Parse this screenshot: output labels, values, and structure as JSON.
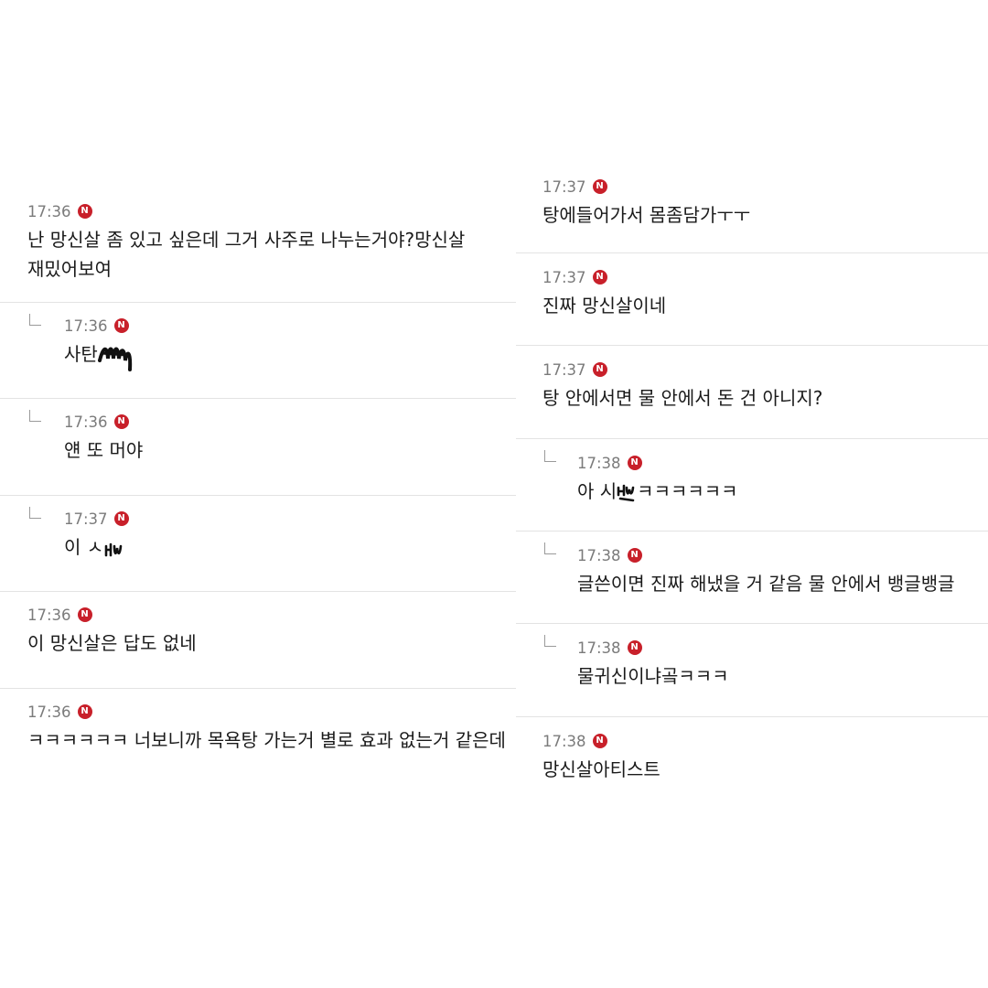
{
  "badge_letter": "N",
  "badge_color": "#c8202a",
  "left_comments": [
    {
      "time": "17:36",
      "reply": false,
      "text": "난 망신살 좀 있고 싶은데 그거 사주로 나누는거야?망신살 재밌어보여"
    },
    {
      "time": "17:36",
      "reply": true,
      "text": "사탄"
    },
    {
      "time": "17:36",
      "reply": true,
      "text": "얜 또 머야"
    },
    {
      "time": "17:37",
      "reply": true,
      "text": "이 ㅅ"
    },
    {
      "time": "17:36",
      "reply": false,
      "text": "이 망신살은 답도 없네"
    },
    {
      "time": "17:36",
      "reply": false,
      "text": "ㅋㅋㅋㅋㅋㅋ 너보니까 목욕탕 가는거 별로 효과 없는거 같은데"
    }
  ],
  "right_comments": [
    {
      "time": "17:37",
      "reply": false,
      "text": "탕에들어가서 몸좀담가ㅜㅜ"
    },
    {
      "time": "17:37",
      "reply": false,
      "text": "진짜 망신살이네"
    },
    {
      "time": "17:37",
      "reply": false,
      "text": "탕 안에서면 물 안에서 돈 건 아니지?"
    },
    {
      "time": "17:38",
      "reply": true,
      "text": "아 시"
    },
    {
      "time": "17:38",
      "reply": true,
      "text": "글쓴이면 진짜 해냈을 거 같음 물 안에서 뱅글뱅글"
    },
    {
      "time": "17:38",
      "reply": true,
      "text": "물귀신이냐곸ㅋㅋㅋ"
    },
    {
      "time": "17:38",
      "reply": false,
      "text": "망신살아티스트"
    }
  ],
  "right_reply_suffix": "ㅋㅋㅋㅋㅋㅋ"
}
